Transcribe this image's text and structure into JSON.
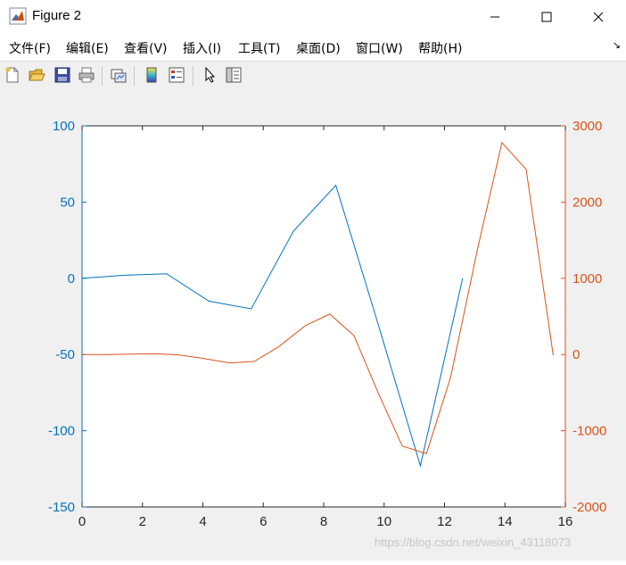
{
  "window": {
    "title": "Figure 2",
    "icon": "matlab-logo-icon",
    "controls": {
      "minimize": "minimize-icon",
      "maximize": "maximize-icon",
      "close": "close-icon"
    }
  },
  "menubar": {
    "items": [
      {
        "label": "文件(F)"
      },
      {
        "label": "编辑(E)"
      },
      {
        "label": "查看(V)"
      },
      {
        "label": "插入(I)"
      },
      {
        "label": "工具(T)"
      },
      {
        "label": "桌面(D)"
      },
      {
        "label": "窗口(W)"
      },
      {
        "label": "帮助(H)"
      }
    ],
    "dock_icon": "dock-arrow-icon"
  },
  "toolbar": {
    "buttons": [
      {
        "icon": "new-figure-icon"
      },
      {
        "icon": "open-file-icon"
      },
      {
        "icon": "save-icon"
      },
      {
        "icon": "print-icon"
      },
      {
        "icon": "link-plot-icon"
      },
      {
        "icon": "insert-colorbar-icon"
      },
      {
        "icon": "insert-legend-icon"
      },
      {
        "icon": "edit-plot-pointer-icon"
      },
      {
        "icon": "open-property-inspector-icon"
      }
    ]
  },
  "chart_data": {
    "type": "line",
    "title": "",
    "xlabel": "",
    "ylabel": "",
    "xlim": [
      0,
      16
    ],
    "x_ticks": [
      "0",
      "2",
      "4",
      "6",
      "8",
      "10",
      "12",
      "14",
      "16"
    ],
    "y_left": {
      "lim": [
        -150,
        100
      ],
      "ticks": [
        "100",
        "50",
        "0",
        "-50",
        "-100",
        "-150"
      ],
      "color": "#0072BD"
    },
    "y_right": {
      "lim": [
        -2000,
        3000
      ],
      "ticks": [
        "3000",
        "2000",
        "1000",
        "0",
        "-1000",
        "-2000"
      ],
      "color": "#D95319"
    },
    "grid": false,
    "series": [
      {
        "axis": "left",
        "color": "#0072BD",
        "x": [
          0,
          1.4,
          2.8,
          4.2,
          5.6,
          7.0,
          8.4,
          9.8,
          11.2,
          12.6
        ],
        "y": [
          0,
          2,
          3,
          -15,
          -20,
          31,
          61,
          -30,
          -123,
          0
        ]
      },
      {
        "axis": "right",
        "color": "#D95319",
        "x": [
          0,
          0.8,
          1.6,
          2.4,
          3.2,
          4.0,
          4.9,
          5.7,
          6.5,
          7.4,
          8.2,
          9.0,
          9.8,
          10.6,
          11.4,
          12.2,
          13.1,
          13.9,
          14.7,
          15.6
        ],
        "y": [
          0,
          0,
          5,
          10,
          -5,
          -50,
          -110,
          -90,
          100,
          380,
          530,
          250,
          -500,
          -1200,
          -1300,
          -300,
          1400,
          2780,
          2430,
          -10
        ]
      }
    ]
  },
  "watermark": "https://blog.csdn.net/weixin_43118073"
}
